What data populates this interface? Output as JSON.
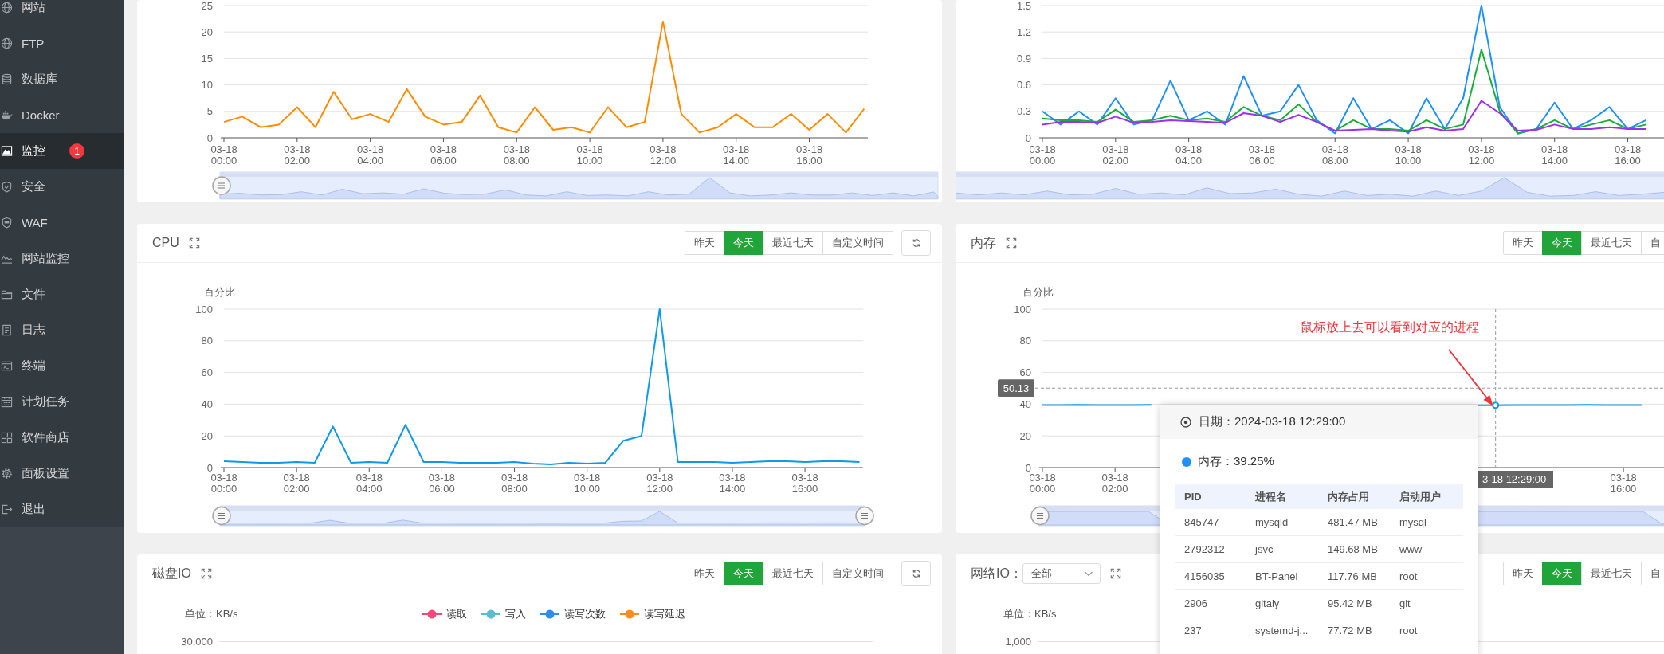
{
  "sidebar": {
    "items": [
      {
        "label": "网站",
        "selected": false
      },
      {
        "label": "FTP",
        "selected": false
      },
      {
        "label": "数据库",
        "selected": false
      },
      {
        "label": "Docker",
        "selected": false
      },
      {
        "label": "监控",
        "selected": true,
        "badge": "1"
      },
      {
        "label": "安全",
        "selected": false
      },
      {
        "label": "WAF",
        "selected": false
      },
      {
        "label": "网站监控",
        "selected": false
      },
      {
        "label": "文件",
        "selected": false
      },
      {
        "label": "日志",
        "selected": false
      },
      {
        "label": "终端",
        "selected": false
      },
      {
        "label": "计划任务",
        "selected": false
      },
      {
        "label": "软件商店",
        "selected": false
      },
      {
        "label": "面板设置",
        "selected": false
      },
      {
        "label": "退出",
        "selected": false
      }
    ]
  },
  "panels": [
    {
      "kind": "chart",
      "chart_data": {
        "type": "line",
        "categories": [
          "03-18 00:00",
          null,
          null,
          null,
          "03-18 02:00",
          null,
          null,
          null,
          "03-18 04:00",
          null,
          null,
          null,
          "03-18 06:00",
          null,
          null,
          null,
          "03-18 08:00",
          null,
          null,
          null,
          "03-18 10:00",
          null,
          null,
          null,
          "03-18 12:00",
          null,
          null,
          null,
          "03-18 14:00",
          null,
          null,
          null,
          "03-18 16:00",
          null,
          null,
          null
        ],
        "ylim": [
          0,
          25
        ],
        "grid": true,
        "yticks": [
          0,
          5,
          10,
          15,
          20,
          25
        ],
        "series": [
          {
            "color": "#ff8c00",
            "values": [
              3,
              4,
              2,
              2.5,
              5.8,
              2,
              8.7,
              3.5,
              4.5,
              3,
              9.2,
              4,
              2.5,
              3,
              8,
              2,
              1,
              5.8,
              1.5,
              2,
              1,
              5.8,
              2,
              3,
              22,
              4.5,
              1,
              2,
              4.5,
              2,
              2,
              4.5,
              1.5,
              4.5,
              1,
              5.5
            ]
          }
        ]
      }
    },
    {
      "kind": "chart",
      "chart_data": {
        "type": "line",
        "categories": [
          "03-18 00:00",
          null,
          null,
          null,
          "03-18 02:00",
          null,
          null,
          null,
          "03-18 04:00",
          null,
          null,
          null,
          "03-18 06:00",
          null,
          null,
          null,
          "03-18 08:00",
          null,
          null,
          null,
          "03-18 10:00",
          null,
          null,
          null,
          "03-18 12:00",
          null,
          null,
          null,
          "03-18 14:00",
          null,
          null,
          null,
          "03-18 16:00",
          null,
          null,
          null
        ],
        "ylim": [
          0,
          1.5
        ],
        "grid": true,
        "yticks": [
          0,
          0.3,
          0.6,
          0.9,
          1.2,
          1.5
        ],
        "series": [
          {
            "color": "#1e90ff",
            "values": [
              0.3,
              0.15,
              0.3,
              0.15,
              0.45,
              0.15,
              0.2,
              0.65,
              0.2,
              0.3,
              0.15,
              0.7,
              0.25,
              0.3,
              0.6,
              0.2,
              0.05,
              0.45,
              0.1,
              0.2,
              0.05,
              0.45,
              0.1,
              0.45,
              1.5,
              0.35,
              0.05,
              0.1,
              0.4,
              0.1,
              0.2,
              0.35,
              0.1,
              0.2,
              null,
              null
            ]
          },
          {
            "color": "#1aad3a",
            "values": [
              0.22,
              0.2,
              0.2,
              0.18,
              0.32,
              0.18,
              0.2,
              0.25,
              0.2,
              0.22,
              0.18,
              0.35,
              0.25,
              0.2,
              0.38,
              0.18,
              0.08,
              0.2,
              0.1,
              0.1,
              0.08,
              0.2,
              0.1,
              0.15,
              1.0,
              0.3,
              0.05,
              0.1,
              0.2,
              0.1,
              0.15,
              0.2,
              0.1,
              0.15,
              null,
              null
            ]
          },
          {
            "color": "#9b30f0",
            "values": [
              0.15,
              0.18,
              0.18,
              0.17,
              0.24,
              0.17,
              0.18,
              0.2,
              0.19,
              0.18,
              0.17,
              0.28,
              0.25,
              0.18,
              0.26,
              0.18,
              0.08,
              0.09,
              0.1,
              0.08,
              0.07,
              0.12,
              0.08,
              0.1,
              0.42,
              0.28,
              0.08,
              0.09,
              0.15,
              0.1,
              0.1,
              0.12,
              0.1,
              0.1,
              null,
              null
            ]
          }
        ]
      }
    },
    {
      "kind": "chart",
      "title": "CPU",
      "range_buttons": [
        {
          "label": "昨天",
          "selected": false
        },
        {
          "label": "今天",
          "selected": true
        },
        {
          "label": "最近七天",
          "selected": false
        },
        {
          "label": "自定义时间",
          "selected": false
        }
      ],
      "refresh_button": true,
      "chart_data": {
        "type": "line",
        "ylabel": "百分比",
        "grid": true,
        "categories": [
          "03-18 00:00",
          null,
          null,
          null,
          "03-18 02:00",
          null,
          null,
          null,
          "03-18 04:00",
          null,
          null,
          null,
          "03-18 06:00",
          null,
          null,
          null,
          "03-18 08:00",
          null,
          null,
          null,
          "03-18 10:00",
          null,
          null,
          null,
          "03-18 12:00",
          null,
          null,
          null,
          "03-18 14:00",
          null,
          null,
          null,
          "03-18 16:00",
          null,
          null,
          null
        ],
        "ylim": [
          0,
          100
        ],
        "yticks": [
          0,
          20,
          40,
          60,
          80,
          100
        ],
        "series": [
          {
            "color": "#0e9ae8",
            "values": [
              4,
              3.5,
              3,
              3,
              3.5,
              3,
              26,
              3,
              3.5,
              3,
              27,
              3.5,
              3.5,
              3,
              3,
              3,
              3.5,
              2.5,
              2,
              3,
              2.5,
              3,
              17,
              20,
              100,
              3.5,
              3.5,
              3.5,
              3,
              3.5,
              4,
              4,
              3.5,
              4,
              4,
              3.5
            ]
          }
        ]
      }
    },
    {
      "kind": "chart",
      "title": "内存",
      "range_buttons": [
        {
          "label": "昨天",
          "selected": false
        },
        {
          "label": "今天",
          "selected": true
        },
        {
          "label": "最近七天",
          "selected": false
        },
        {
          "label": "自",
          "selected": false
        }
      ],
      "chart_data": {
        "type": "line",
        "ylabel": "百分比",
        "grid": true,
        "categories": [
          "03-18 00:00",
          null,
          null,
          null,
          "03-18 02:00",
          null,
          null,
          null,
          null,
          null,
          null,
          null,
          null,
          null,
          null,
          null,
          null,
          null,
          null,
          null,
          null,
          null,
          null,
          null,
          null,
          null,
          null,
          null,
          null,
          null,
          null,
          null,
          "03-18 16:00",
          null,
          null,
          null
        ],
        "ylim": [
          0,
          100
        ],
        "yticks": [
          0,
          20,
          40,
          60,
          80,
          100
        ],
        "series": [
          {
            "color": "#0e9ae8",
            "values": [
              39.5,
              39.4,
              39.6,
              39.5,
              39.5,
              39.4,
              39.6,
              null,
              null,
              null,
              null,
              null,
              null,
              null,
              null,
              null,
              null,
              null,
              null,
              null,
              null,
              null,
              null,
              null,
              39.3,
              39.3,
              39.4,
              39.5,
              39.4,
              39.5,
              39.6,
              39.5,
              39.4,
              39.5,
              null,
              null
            ]
          }
        ],
        "annotations": [
          {
            "text": "鼠标放上去可以看到对应的进程"
          }
        ],
        "ref_lines": [
          {
            "axis": "y",
            "value": 50.13
          }
        ]
      },
      "axis_pointer": {
        "y_label": "50.13",
        "x_label": "3-18 12:29:00"
      },
      "tooltip": {
        "date": "日期：2024-03-18 12:29:00",
        "value": "内存：39.25%",
        "columns": [
          "PID",
          "进程名",
          "内存占用",
          "启动用户"
        ],
        "rows": [
          [
            "845747",
            "mysqld",
            "481.47 MB",
            "mysql"
          ],
          [
            "2792312",
            "jsvc",
            "149.68 MB",
            "www"
          ],
          [
            "4156035",
            "BT-Panel",
            "117.76 MB",
            "root"
          ],
          [
            "2906",
            "gitaly",
            "95.42 MB",
            "git"
          ],
          [
            "237",
            "systemd-j...",
            "77.72 MB",
            "root"
          ]
        ]
      }
    },
    {
      "kind": "io",
      "title": "磁盘IO",
      "range_buttons": [
        {
          "label": "昨天",
          "selected": false
        },
        {
          "label": "今天",
          "selected": true
        },
        {
          "label": "最近七天",
          "selected": false
        },
        {
          "label": "自定义时间",
          "selected": false
        }
      ],
      "refresh_button": true,
      "unit": "单位：KB/s",
      "legend": [
        {
          "label": "读取",
          "color": "#f0487b"
        },
        {
          "label": "写入",
          "color": "#5bbccd"
        },
        {
          "label": "读写次数",
          "color": "#2e8cf0"
        },
        {
          "label": "读写延迟",
          "color": "#ff8c1a"
        }
      ],
      "tick": "30,000"
    },
    {
      "kind": "io",
      "title": "网络IO：",
      "filter_select": {
        "value": "全部"
      },
      "range_buttons": [
        {
          "label": "昨天",
          "selected": false
        },
        {
          "label": "今天",
          "selected": true
        },
        {
          "label": "最近七天",
          "selected": false
        },
        {
          "label": "自",
          "selected": false
        }
      ],
      "unit": "单位：KB/s",
      "tick": "1,000"
    }
  ]
}
